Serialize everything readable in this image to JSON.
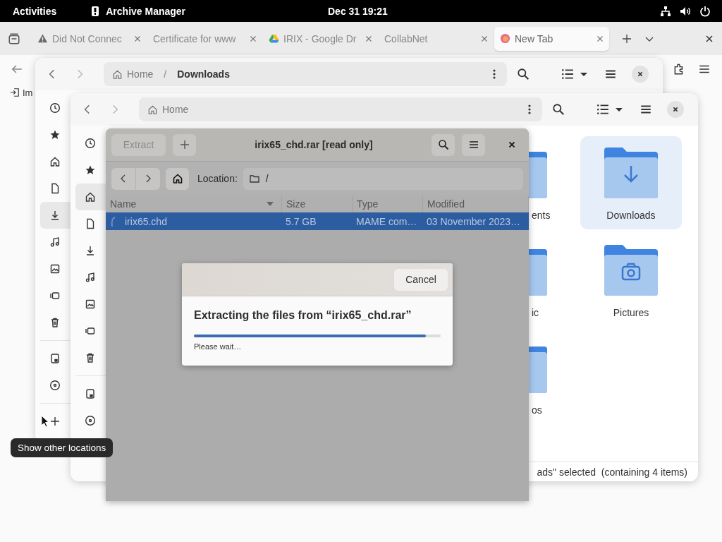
{
  "top_bar": {
    "activities": "Activities",
    "app": "Archive Manager",
    "clock": "Dec 31  19:21"
  },
  "browser": {
    "tabs": [
      {
        "label": "Did Not Connec",
        "kind": "warning",
        "selected": false
      },
      {
        "label": "Certificate for www",
        "kind": "none",
        "selected": false
      },
      {
        "label": "IRIX - Google Dr",
        "kind": "drive",
        "selected": false
      },
      {
        "label": "CollabNet",
        "kind": "none",
        "selected": false
      },
      {
        "label": "New Tab",
        "kind": "browser",
        "selected": true
      }
    ],
    "bookmark": "Im"
  },
  "file_manager_back": {
    "path": [
      {
        "label": "Home",
        "kind": "home"
      },
      {
        "label": "Downloads",
        "kind": "folder",
        "separator": "/"
      }
    ],
    "sidebar": [
      {
        "kind": "recent",
        "selected": false
      },
      {
        "kind": "starred",
        "selected": false
      },
      {
        "kind": "home",
        "selected": false
      },
      {
        "kind": "documents",
        "selected": false
      },
      {
        "kind": "downloads",
        "selected": true
      },
      {
        "kind": "music",
        "selected": false
      },
      {
        "kind": "pictures",
        "selected": false
      },
      {
        "kind": "videos",
        "selected": false
      },
      {
        "kind": "trash",
        "selected": false
      },
      {
        "kind": "separator"
      },
      {
        "kind": "drive",
        "selected": false
      },
      {
        "kind": "disc",
        "selected": false
      },
      {
        "kind": "separator"
      },
      {
        "kind": "other",
        "selected": false
      }
    ]
  },
  "file_manager_front": {
    "path": [
      {
        "label": "Home",
        "kind": "home"
      }
    ],
    "sidebar": [
      {
        "kind": "recent",
        "selected": false
      },
      {
        "kind": "starred",
        "selected": false
      },
      {
        "kind": "home",
        "selected": true
      },
      {
        "kind": "documents",
        "selected": false
      },
      {
        "kind": "downloads",
        "selected": false
      },
      {
        "kind": "music",
        "selected": false
      },
      {
        "kind": "pictures",
        "selected": false
      },
      {
        "kind": "videos",
        "selected": false
      },
      {
        "kind": "trash",
        "selected": false
      },
      {
        "kind": "separator"
      },
      {
        "kind": "drive",
        "selected": false
      },
      {
        "kind": "disc",
        "selected": false
      }
    ],
    "folders": [
      {
        "label": "ents",
        "kind": "documents",
        "clipped": true,
        "selected": false
      },
      {
        "label": "Downloads",
        "kind": "downloads",
        "clipped": false,
        "selected": true
      },
      {
        "label": "ic",
        "kind": "music",
        "clipped": true,
        "selected": false
      },
      {
        "label": "Pictures",
        "kind": "pictures",
        "clipped": false,
        "selected": false
      },
      {
        "label": "os",
        "kind": "videos",
        "clipped": true,
        "selected": false
      }
    ],
    "status": "ads\" selected  (containing 4 items)"
  },
  "archive_manager": {
    "title": "irix65_chd.rar [read only]",
    "extract": {
      "label": "Extract",
      "disabled": true
    },
    "location_label": "Location:",
    "location": "/",
    "columns": [
      "Name",
      "Size",
      "Type",
      "Modified"
    ],
    "rows": [
      {
        "name": "irix65.chd",
        "size": "5.7 GB",
        "type": "MAME com…",
        "modified": "03 November 2023…",
        "selected": true
      }
    ]
  },
  "progress_dialog": {
    "cancel": "Cancel",
    "heading": "Extracting the files from “irix65_chd.rar”",
    "level": 0.94,
    "status": "Please wait…"
  },
  "tooltip": "Show other locations"
}
